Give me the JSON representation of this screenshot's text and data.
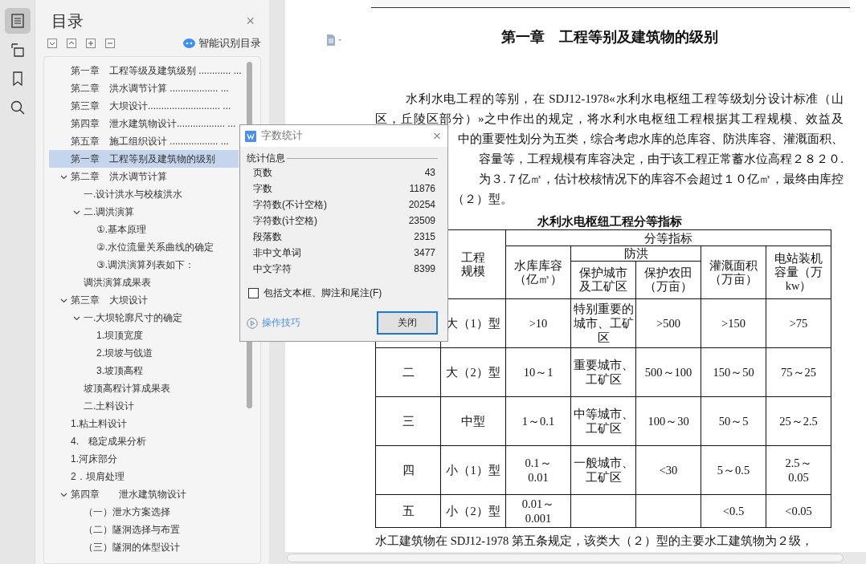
{
  "rail": [
    {
      "kind": "toc",
      "selected": true
    },
    {
      "kind": "outline",
      "selected": false
    },
    {
      "kind": "bookmark",
      "selected": false
    },
    {
      "kind": "search",
      "selected": false
    }
  ],
  "toc": {
    "title": "目录",
    "close": "×",
    "smart_button": "智能识别目录",
    "tools": [
      {
        "kind": "expand"
      },
      {
        "kind": "collapse"
      },
      {
        "kind": "plus"
      },
      {
        "kind": "minus"
      }
    ],
    "items": [
      {
        "text": "第一章　工程等级及建筑级别 ............ ...",
        "selected": false
      },
      {
        "text": "第二章　洪水调节计算 .................. ...",
        "selected": false
      },
      {
        "text": "第三章　大坝设计........................... ...",
        "selected": false
      },
      {
        "text": "第四章　泄水建筑物设计.................. ...",
        "selected": false
      },
      {
        "text": "第五章　施工组织设计 .................. ...",
        "selected": false
      },
      {
        "text": "第一章　工程等别及建筑物的级别",
        "selected": true
      },
      {
        "text": "第二章　洪水调节计算",
        "selected": false,
        "expanded": true,
        "children": [
          {
            "text": "一.设计洪水与校核洪水",
            "selected": false
          },
          {
            "text": "二.调洪演算",
            "selected": false,
            "expanded": true,
            "children": [
              {
                "text": "①.基本原理",
                "selected": false
              },
              {
                "text": "②.水位流量关系曲线的确定",
                "selected": false
              },
              {
                "text": "③.调洪演算列表如下：",
                "selected": false
              }
            ]
          },
          {
            "text": "调洪演算成果表",
            "selected": false
          }
        ]
      },
      {
        "text": "第三章　大坝设计",
        "selected": false,
        "expanded": true,
        "children": [
          {
            "text": "一.大坝轮廓尺寸的确定",
            "selected": false,
            "expanded": true,
            "children": [
              {
                "text": "1.坝顶宽度",
                "selected": false
              },
              {
                "text": "2.坝坡与戗道",
                "selected": false
              },
              {
                "text": "3.坡顶高程",
                "selected": false
              }
            ]
          },
          {
            "text": "坡顶高程计算成果表",
            "selected": false
          },
          {
            "text": "二.土料设计",
            "selected": false
          }
        ]
      },
      {
        "text": "1.粘土料设计",
        "selected": false
      },
      {
        "text": "4.　稳定成果分析",
        "selected": false
      },
      {
        "text": "1.河床部分",
        "selected": false
      },
      {
        "text": "2．坝肩处理",
        "selected": false
      },
      {
        "text": "第四章　　泄水建筑物设计",
        "selected": false,
        "expanded": true,
        "children": [
          {
            "text": "（一）泄水方案选择",
            "selected": false
          },
          {
            "text": "（二）隧洞选择与布置",
            "selected": false
          },
          {
            "text": "（三）隧洞的体型设计",
            "selected": false
          }
        ]
      }
    ]
  },
  "doc": {
    "heading": "第一章　工程等别及建筑物的级别",
    "lines": [
      {
        "kind": "first",
        "text": "水利水电工程的等别，在 SDJ12-1978«水利水电枢纽工程等级划分设计标准（山"
      },
      {
        "kind": "full",
        "text": "区，丘陵区部分）»之中作出的规定，将水利水电枢纽工程根据其工程规模、效益及"
      },
      {
        "kind": "covered",
        "text": "中的重要性划分为五类，综合考虑水库的总库容、防洪库容、灌溉面积、"
      },
      {
        "kind": "covered",
        "text": "容量等，工程规模有库容决定，由于该工程正常蓄水位高程２８２０."
      },
      {
        "kind": "covered",
        "text": "为３.７亿㎥，估计校核情况下的库容不会超过１０亿㎥，最终由库控"
      },
      {
        "kind": "covered_start",
        "text": "（２）型。"
      }
    ],
    "table": {
      "title": "水利水电枢纽工程分等指标",
      "header": {
        "group": "分等指标",
        "scale": "工程规模",
        "capacity": "水库库容（亿㎥）",
        "flood": "防洪",
        "flood_city": "保护城市及工矿区",
        "flood_farm": "保护农田（万亩）",
        "irrigation": "灌溉面积（万亩）",
        "power": "电站装机容量（万 kw）"
      },
      "rows": [
        {
          "scale": "大（1）型",
          "capacity": ">10",
          "city": "特别重要的城市、工矿区",
          "farm": ">500",
          "irrigation": ">150",
          "power": ">75"
        },
        {
          "grade": "二",
          "scale": "大（2）型",
          "capacity": "10～1",
          "city": "重要城市、工矿区",
          "farm": "500～100",
          "irrigation": "150～50",
          "power": "75～25"
        },
        {
          "grade": "三",
          "scale": "中型",
          "capacity": "1～0.1",
          "city": "中等城市、工矿区",
          "farm": "100～30",
          "irrigation": "50～5",
          "power": "25～2.5"
        },
        {
          "grade": "四",
          "scale": "小（1）型",
          "capacity": "0.1～\n0.01",
          "city": "一般城市、工矿区",
          "farm": "<30",
          "irrigation": "5～0.5",
          "power": "2.5～\n0.05"
        },
        {
          "grade": "五",
          "scale": "小（2）型",
          "capacity": "0.01～\n0.001",
          "irrigation": "<0.5",
          "power": "<0.05"
        }
      ]
    },
    "last_line": "水工建筑物在 SDJ12-1978 第五条规定，该类大（２）型的主要水工建筑物为２级，"
  },
  "dialog": {
    "title": "字数统计",
    "close": "×",
    "group": "统计信息",
    "stats": [
      {
        "label": "页数",
        "value": "43"
      },
      {
        "label": "字数",
        "value": "11876"
      },
      {
        "label": "字符数(不计空格)",
        "value": "20254"
      },
      {
        "label": "字符数(计空格)",
        "value": "23509"
      },
      {
        "label": "段落数",
        "value": "2315"
      },
      {
        "label": "非中文单词",
        "value": "3477"
      },
      {
        "label": "中文字符",
        "value": "8399"
      }
    ],
    "checkbox": {
      "label": "包括文本框、脚注和尾注(F)",
      "checked": false
    },
    "tips_link": "操作技巧",
    "close_button": "关闭"
  }
}
